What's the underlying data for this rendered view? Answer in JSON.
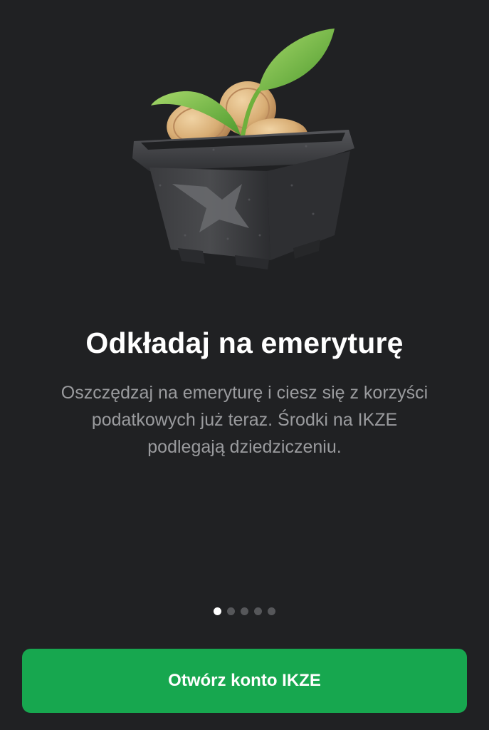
{
  "onboarding": {
    "title": "Odkładaj na emeryturę",
    "description_lines": [
      "Oszczędzaj na emeryturę i ciesz się z korzyści",
      "podatkowych już teraz. Środki na IKZE",
      "podlegają dziedziczeniu."
    ],
    "page_indicator": {
      "current": 1,
      "total": 5
    },
    "cta_label": "Otwórz konto IKZE",
    "illustration": "plant-pot-with-coins-illustration"
  },
  "colors": {
    "background": "#202123",
    "accent": "#17a74f",
    "text_primary": "#ffffff",
    "text_secondary": "#9a9b9e"
  }
}
